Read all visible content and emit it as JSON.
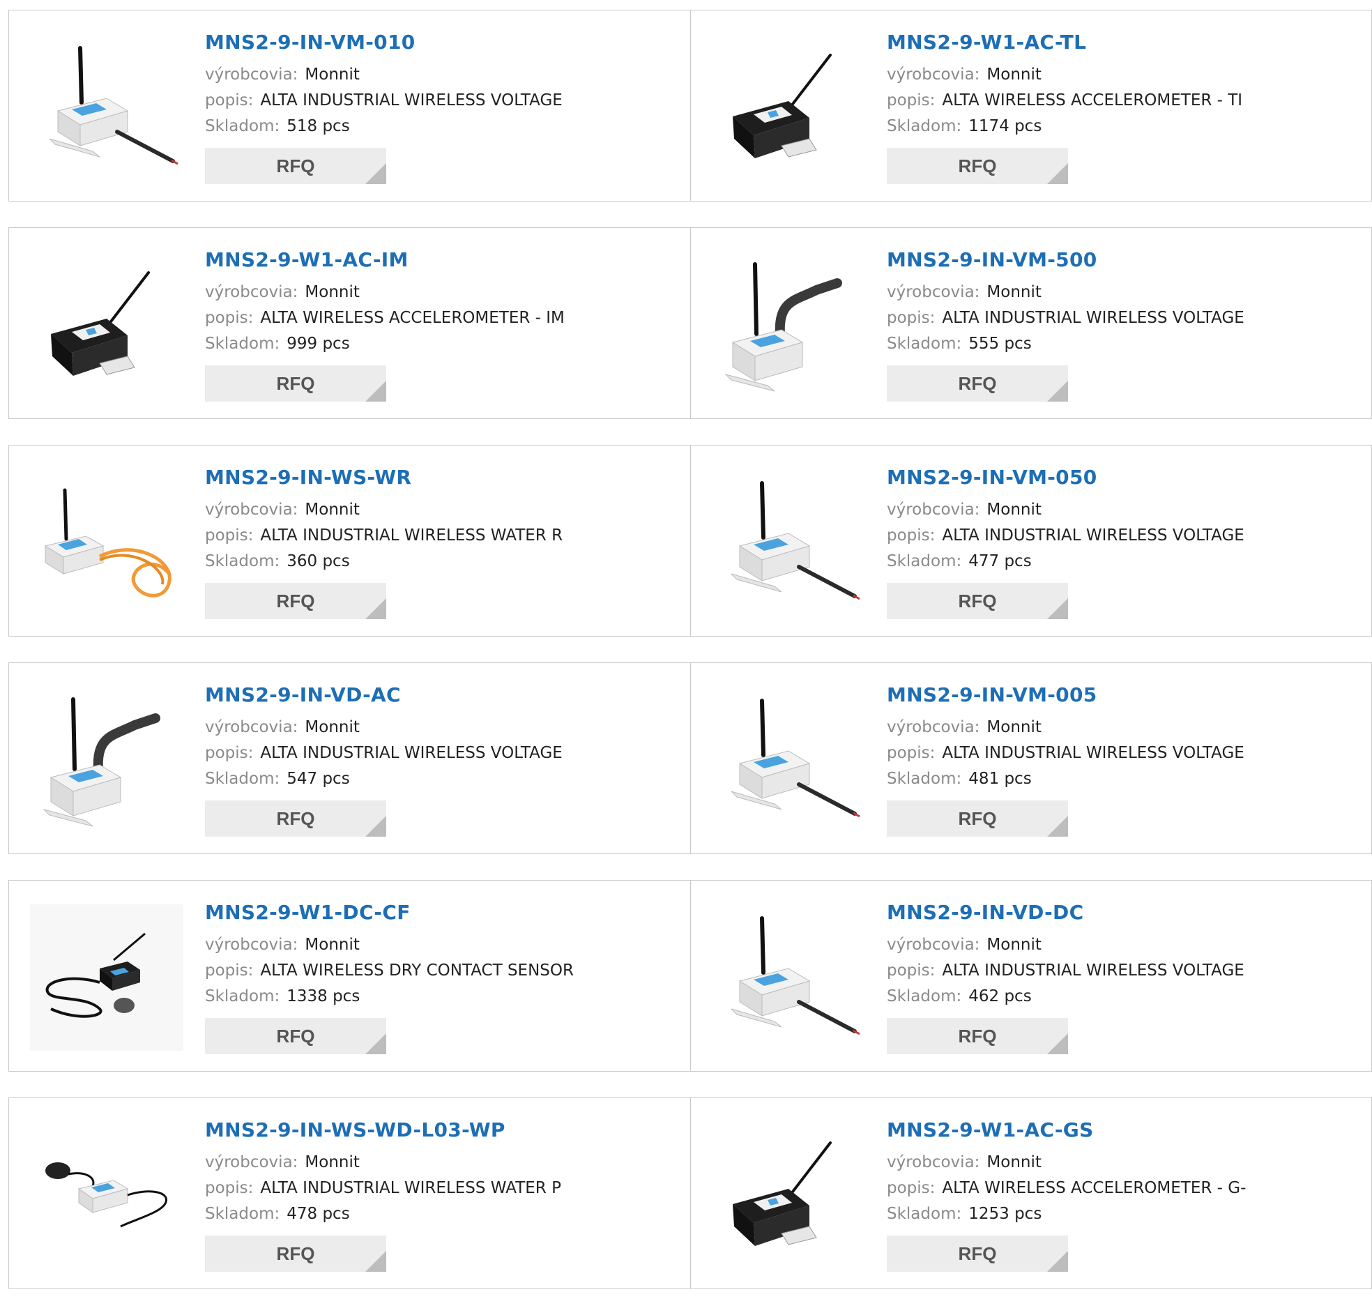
{
  "labels": {
    "manufacturer": "výrobcovia:",
    "description": "popis:",
    "stock": "Skladom:",
    "rfq": "RFQ"
  },
  "products": [
    {
      "part": "MNS2-9-IN-VM-010",
      "manufacturer": "Monnit",
      "description": "ALTA INDUSTRIAL WIRELESS VOLTAGE",
      "stock": "518 pcs",
      "image": "white-sensor-cable-icon"
    },
    {
      "part": "MNS2-9-W1-AC-TL",
      "manufacturer": "Monnit",
      "description": "ALTA WIRELESS ACCELEROMETER - TI",
      "stock": "1174 pcs",
      "image": "black-sensor-icon"
    },
    {
      "part": "MNS2-9-W1-AC-IM",
      "manufacturer": "Monnit",
      "description": "ALTA WIRELESS ACCELEROMETER - IM",
      "stock": "999 pcs",
      "image": "black-sensor-icon"
    },
    {
      "part": "MNS2-9-IN-VM-500",
      "manufacturer": "Monnit",
      "description": "ALTA INDUSTRIAL WIRELESS VOLTAGE",
      "stock": "555 pcs",
      "image": "white-sensor-conduit-icon"
    },
    {
      "part": "MNS2-9-IN-WS-WR",
      "manufacturer": "Monnit",
      "description": "ALTA INDUSTRIAL WIRELESS WATER R",
      "stock": "360 pcs",
      "image": "white-sensor-orange-cable-icon"
    },
    {
      "part": "MNS2-9-IN-VM-050",
      "manufacturer": "Monnit",
      "description": "ALTA INDUSTRIAL WIRELESS VOLTAGE",
      "stock": "477 pcs",
      "image": "white-sensor-cable-icon"
    },
    {
      "part": "MNS2-9-IN-VD-AC",
      "manufacturer": "Monnit",
      "description": "ALTA INDUSTRIAL WIRELESS VOLTAGE",
      "stock": "547 pcs",
      "image": "white-sensor-conduit-icon"
    },
    {
      "part": "MNS2-9-IN-VM-005",
      "manufacturer": "Monnit",
      "description": "ALTA INDUSTRIAL WIRELESS VOLTAGE",
      "stock": "481 pcs",
      "image": "white-sensor-cable-icon"
    },
    {
      "part": "MNS2-9-W1-DC-CF",
      "manufacturer": "Monnit",
      "description": "ALTA WIRELESS DRY CONTACT SENSOR",
      "stock": "1338 pcs",
      "image": "dry-contact-sensor-icon"
    },
    {
      "part": "MNS2-9-IN-VD-DC",
      "manufacturer": "Monnit",
      "description": "ALTA INDUSTRIAL WIRELESS VOLTAGE",
      "stock": "462 pcs",
      "image": "white-sensor-cable-icon"
    },
    {
      "part": "MNS2-9-IN-WS-WD-L03-WP",
      "manufacturer": "Monnit",
      "description": "ALTA INDUSTRIAL WIRELESS WATER P",
      "stock": "478 pcs",
      "image": "water-puck-sensor-icon"
    },
    {
      "part": "MNS2-9-W1-AC-GS",
      "manufacturer": "Monnit",
      "description": "ALTA WIRELESS ACCELEROMETER - G-",
      "stock": "1253 pcs",
      "image": "black-sensor-icon"
    }
  ]
}
